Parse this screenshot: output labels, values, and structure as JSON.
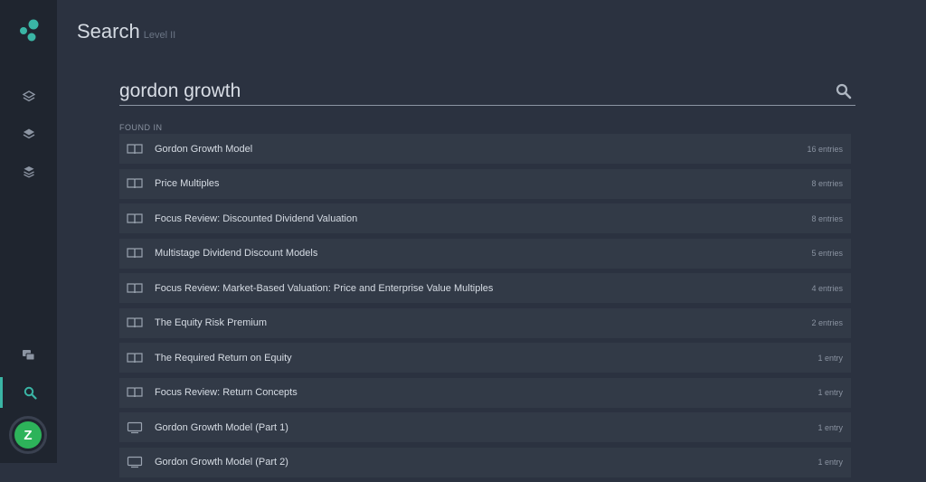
{
  "header": {
    "title": "Search",
    "subtitle": "Level II"
  },
  "search": {
    "value": "gordon growth",
    "placeholder": ""
  },
  "found_label": "FOUND IN",
  "results": [
    {
      "type": "book",
      "title": "Gordon Growth Model",
      "count": "16 entries"
    },
    {
      "type": "book",
      "title": "Price Multiples",
      "count": "8 entries"
    },
    {
      "type": "book",
      "title": "Focus Review: Discounted Dividend Valuation",
      "count": "8 entries"
    },
    {
      "type": "book",
      "title": "Multistage Dividend Discount Models",
      "count": "5 entries"
    },
    {
      "type": "book",
      "title": "Focus Review: Market-Based Valuation: Price and Enterprise Value Multiples",
      "count": "4 entries"
    },
    {
      "type": "book",
      "title": "The Equity Risk Premium",
      "count": "2 entries"
    },
    {
      "type": "book",
      "title": "The Required Return on Equity",
      "count": "1 entry"
    },
    {
      "type": "book",
      "title": "Focus Review: Return Concepts",
      "count": "1 entry"
    },
    {
      "type": "video",
      "title": "Gordon Growth Model (Part 1)",
      "count": "1 entry"
    },
    {
      "type": "video",
      "title": "Gordon Growth Model (Part 2)",
      "count": "1 entry"
    }
  ],
  "sidebar": {
    "avatar_initial": "Z",
    "icons": [
      "layers-icon",
      "layers-filled-icon",
      "stack-icon",
      "chat-icon",
      "search-icon"
    ]
  },
  "colors": {
    "accent": "#3ab5a5",
    "avatar": "#2db35a",
    "background": "#2b3240",
    "sidebar": "#1f252f"
  }
}
